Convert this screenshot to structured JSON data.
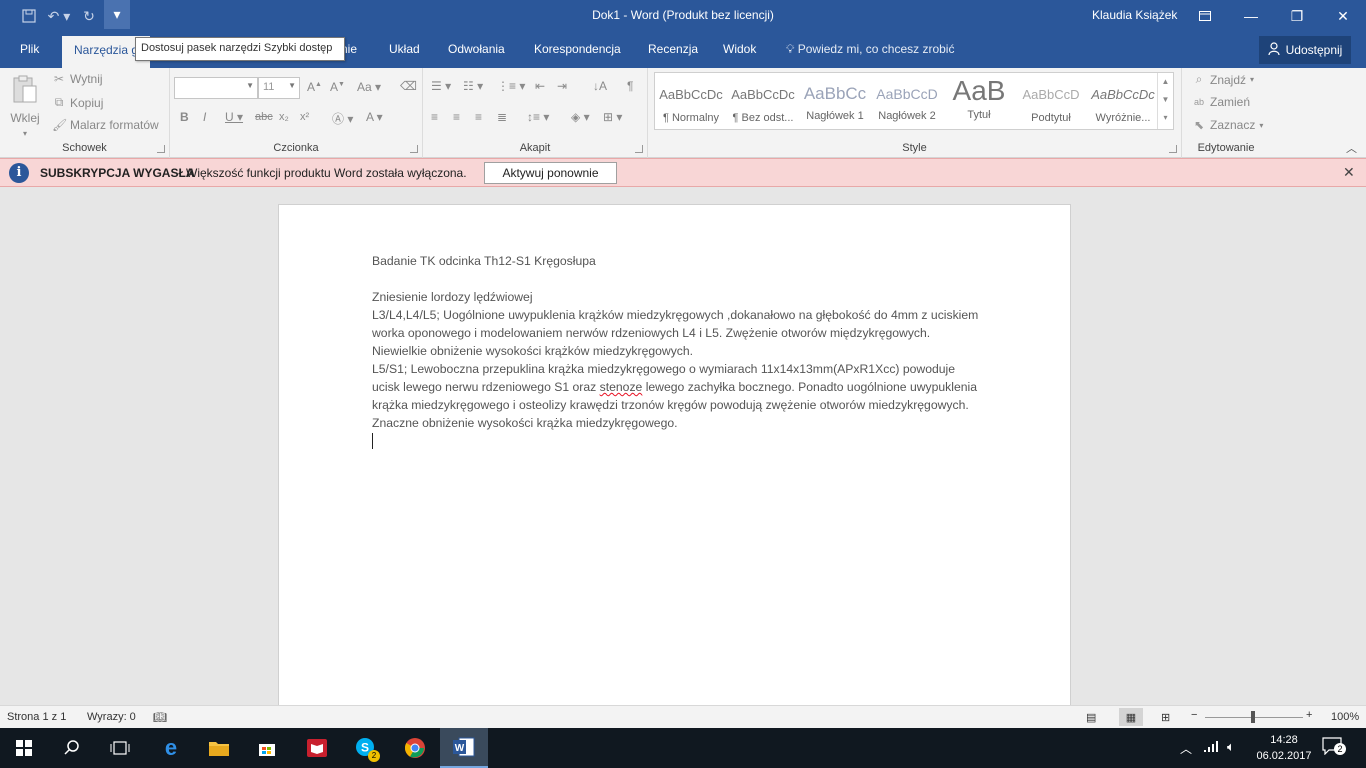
{
  "window": {
    "title": "Dok1  -  Word (Produkt bez licencji)",
    "user": "Klaudia Książek"
  },
  "qat": {
    "tooltip": "Dostosuj pasek narzędzi Szybki dostęp"
  },
  "tabs": {
    "file": "Plik",
    "home_partial": "Narzędzia g",
    "insert_partial": "nie",
    "layout": "Układ",
    "references": "Odwołania",
    "mailings": "Korespondencja",
    "review": "Recenzja",
    "view": "Widok",
    "tell_me": "Powiedz mi, co chcesz zrobić",
    "share": "Udostępnij"
  },
  "ribbon": {
    "clipboard": {
      "label": "Schowek",
      "paste": "Wklej",
      "cut": "Wytnij",
      "copy": "Kopiuj",
      "format_painter": "Malarz formatów"
    },
    "font": {
      "label": "Czcionka",
      "font_name": "",
      "font_size": "11"
    },
    "paragraph": {
      "label": "Akapit"
    },
    "styles": {
      "label": "Style",
      "items": [
        {
          "preview": "AaBbCcDc",
          "name": "¶ Normalny"
        },
        {
          "preview": "AaBbCcDc",
          "name": "¶ Bez odst..."
        },
        {
          "preview": "AaBbCc",
          "name": "Nagłówek 1"
        },
        {
          "preview": "AaBbCcD",
          "name": "Nagłówek 2"
        },
        {
          "preview": "AaB",
          "name": "Tytuł"
        },
        {
          "preview": "AaBbCcD",
          "name": "Podtytuł"
        },
        {
          "preview": "AaBbCcDc",
          "name": "Wyróżnie..."
        }
      ]
    },
    "editing": {
      "label": "Edytowanie",
      "find": "Znajdź",
      "replace": "Zamień",
      "select": "Zaznacz"
    }
  },
  "message_bar": {
    "title": "SUBSKRYPCJA WYGASŁA",
    "text": "Większość funkcji produktu Word została wyłączona.",
    "button": "Aktywuj ponownie"
  },
  "document": {
    "heading": "Badanie TK odcinka Th12-S1 Kręgosłupa",
    "line1": "Zniesienie lordozy lędźwiowej",
    "para1": "L3/L4,L4/L5; Uogólnione uwypuklenia krążków miedzykręgowych ,dokanałowo na głębokość do 4mm z uciskiem worka oponowego i modelowaniem nerwów rdzeniowych L4 i L5. Zwężenie otworów międzykręgowych. Niewielkie obniżenie wysokości krążków miedzykręgowych.",
    "para2_a": "L5/S1; Lewoboczna przepuklina krążka miedzykręgowego o wymiarach 11x14x13mm(APxR1Xcc) powoduje ucisk lewego nerwu rdzeniowego S1 oraz ",
    "para2_spell": "stenoze",
    "para2_b": " lewego zachyłka bocznego. Ponadto uogólnione uwypuklenia krążka miedzykręgowego i osteolizy krawędzi trzonów kręgów powodują zwężenie otworów miedzykręgowych. Znaczne obniżenie wysokości krążka miedzykręgowego."
  },
  "status": {
    "page": "Strona 1 z 1",
    "words": "Wyrazy: 0",
    "zoom": "100%"
  },
  "taskbar": {
    "time": "14:28",
    "date": "06.02.2017",
    "skype_badge": "2",
    "notifications": "2"
  }
}
